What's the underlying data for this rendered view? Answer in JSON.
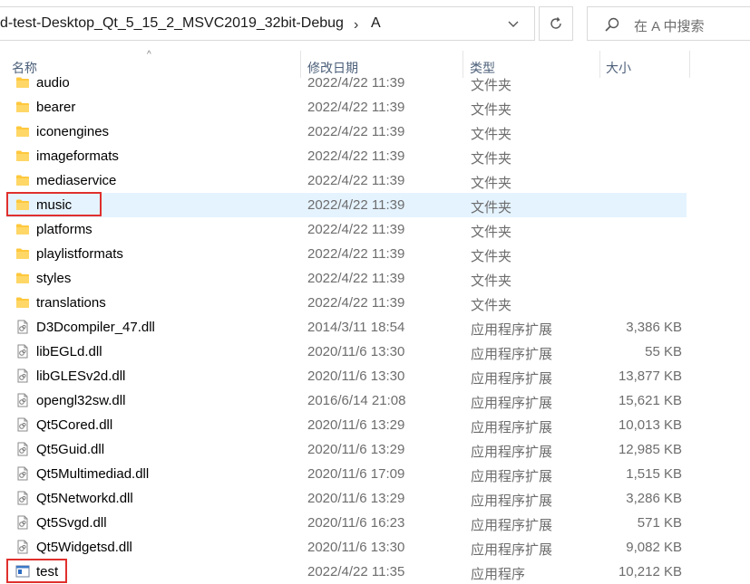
{
  "address_bar": {
    "path_segment": "d-test-Desktop_Qt_5_15_2_MSVC2019_32bit-Debug",
    "current_folder": "A"
  },
  "search": {
    "placeholder": "在 A 中搜索"
  },
  "columns": {
    "name": "名称",
    "modified": "修改日期",
    "type": "类型",
    "size": "大小"
  },
  "files": [
    {
      "name": "audio",
      "modified": "2022/4/22 11:39",
      "type": "文件夹",
      "size": "",
      "icon": "folder-icon"
    },
    {
      "name": "bearer",
      "modified": "2022/4/22 11:39",
      "type": "文件夹",
      "size": "",
      "icon": "folder-icon"
    },
    {
      "name": "iconengines",
      "modified": "2022/4/22 11:39",
      "type": "文件夹",
      "size": "",
      "icon": "folder-icon"
    },
    {
      "name": "imageformats",
      "modified": "2022/4/22 11:39",
      "type": "文件夹",
      "size": "",
      "icon": "folder-icon"
    },
    {
      "name": "mediaservice",
      "modified": "2022/4/22 11:39",
      "type": "文件夹",
      "size": "",
      "icon": "folder-icon"
    },
    {
      "name": "music",
      "modified": "2022/4/22 11:39",
      "type": "文件夹",
      "size": "",
      "icon": "folder-icon",
      "selected": true,
      "highlighted": true
    },
    {
      "name": "platforms",
      "modified": "2022/4/22 11:39",
      "type": "文件夹",
      "size": "",
      "icon": "folder-icon"
    },
    {
      "name": "playlistformats",
      "modified": "2022/4/22 11:39",
      "type": "文件夹",
      "size": "",
      "icon": "folder-icon"
    },
    {
      "name": "styles",
      "modified": "2022/4/22 11:39",
      "type": "文件夹",
      "size": "",
      "icon": "folder-icon"
    },
    {
      "name": "translations",
      "modified": "2022/4/22 11:39",
      "type": "文件夹",
      "size": "",
      "icon": "folder-icon"
    },
    {
      "name": "D3Dcompiler_47.dll",
      "modified": "2014/3/11 18:54",
      "type": "应用程序扩展",
      "size": "3,386 KB",
      "icon": "dll-file-icon"
    },
    {
      "name": "libEGLd.dll",
      "modified": "2020/11/6 13:30",
      "type": "应用程序扩展",
      "size": "55 KB",
      "icon": "dll-file-icon"
    },
    {
      "name": "libGLESv2d.dll",
      "modified": "2020/11/6 13:30",
      "type": "应用程序扩展",
      "size": "13,877 KB",
      "icon": "dll-file-icon"
    },
    {
      "name": "opengl32sw.dll",
      "modified": "2016/6/14 21:08",
      "type": "应用程序扩展",
      "size": "15,621 KB",
      "icon": "dll-file-icon"
    },
    {
      "name": "Qt5Cored.dll",
      "modified": "2020/11/6 13:29",
      "type": "应用程序扩展",
      "size": "10,013 KB",
      "icon": "dll-file-icon"
    },
    {
      "name": "Qt5Guid.dll",
      "modified": "2020/11/6 13:29",
      "type": "应用程序扩展",
      "size": "12,985 KB",
      "icon": "dll-file-icon"
    },
    {
      "name": "Qt5Multimediad.dll",
      "modified": "2020/11/6 17:09",
      "type": "应用程序扩展",
      "size": "1,515 KB",
      "icon": "dll-file-icon"
    },
    {
      "name": "Qt5Networkd.dll",
      "modified": "2020/11/6 13:29",
      "type": "应用程序扩展",
      "size": "3,286 KB",
      "icon": "dll-file-icon"
    },
    {
      "name": "Qt5Svgd.dll",
      "modified": "2020/11/6 16:23",
      "type": "应用程序扩展",
      "size": "571 KB",
      "icon": "dll-file-icon"
    },
    {
      "name": "Qt5Widgetsd.dll",
      "modified": "2020/11/6 13:30",
      "type": "应用程序扩展",
      "size": "9,082 KB",
      "icon": "dll-file-icon"
    },
    {
      "name": "test",
      "modified": "2022/4/22 11:35",
      "type": "应用程序",
      "size": "10,212 KB",
      "icon": "exe-app-icon",
      "highlighted": true
    }
  ],
  "colors": {
    "selection": "#e5f3ff",
    "highlight_box": "#e0302d",
    "folder": "#ffc83d",
    "header_text": "#4c607a"
  }
}
